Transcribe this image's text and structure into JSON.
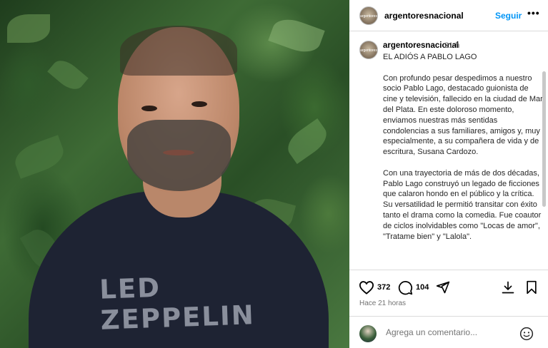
{
  "post": {
    "account": "argentoresnacional",
    "avatar_text": "argentores",
    "follow_label": "Seguir",
    "more_label": "•••",
    "time_ago": "21 h",
    "shirt_text": "LED ZEPPELIN",
    "caption_title": "EL ADIÓS A PABLO LAGO",
    "caption_p1": "Con profundo pesar despedimos a nuestro socio Pablo Lago, destacado guionista de cine y televisión, fallecido en la ciudad de Mar del Plata. En este doloroso momento, enviamos nuestras más sentidas condolencias a sus familiares, amigos y, muy especialmente, a su compañera de vida y de escritura, Susana Cardozo.",
    "caption_p2": "Con una trayectoria de más de dos décadas, Pablo Lago construyó un legado de ficciones que calaron hondo en el público y la crítica. Su versatilidad le permitió transitar con éxito tanto el drama como la comedia. Fue coautor de ciclos inolvidables como \"Locas de amor\", \"Tratame bien\" y \"Lalola\"."
  },
  "actions": {
    "likes": "372",
    "comments": "104",
    "posted_ago": "Hace 21 horas",
    "icons": [
      "heart-icon",
      "comment-icon",
      "share-icon",
      "download-icon",
      "bookmark-icon",
      "emoji-icon"
    ]
  },
  "comment": {
    "placeholder": "Agrega un comentario..."
  },
  "colors": {
    "follow": "#0095f6",
    "muted": "#737373",
    "divider": "#dbdbdb"
  }
}
